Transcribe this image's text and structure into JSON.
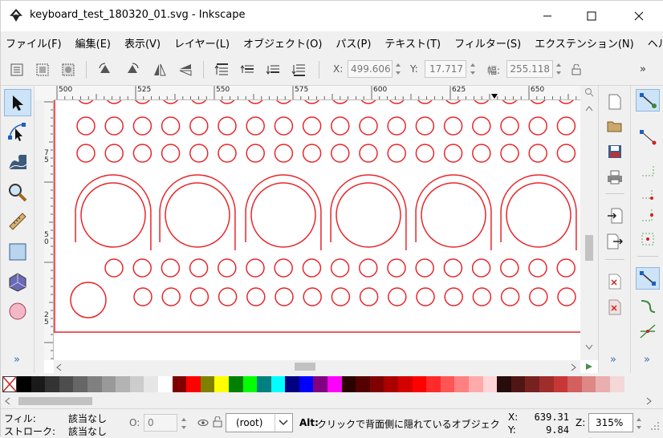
{
  "window": {
    "title": "keyboard_test_180320_01.svg - Inkscape",
    "minimize_glyph": "─",
    "maximize_glyph": "☐",
    "close_glyph": "✕"
  },
  "menu": [
    "ファイル(F)",
    "編集(E)",
    "表示(V)",
    "レイヤー(L)",
    "オブジェクト(O)",
    "パス(P)",
    "テキスト(T)",
    "フィルター(S)",
    "エクステンション(N)",
    "ヘルプ(H)"
  ],
  "toolbar": {
    "x_label": "X:",
    "x_value": "499.606",
    "y_label": "Y:",
    "y_value": "17.717",
    "w_label": "幅:",
    "w_value": "255.118",
    "overflow": "»"
  },
  "rulers": {
    "h_labels": [
      "500",
      "525",
      "550",
      "575",
      "600",
      "625",
      "650"
    ],
    "v_labels": [
      "7\n5",
      "5\n0",
      "2\n5"
    ]
  },
  "toolbox": {
    "overflow": "»"
  },
  "commands": {
    "overflow": "»"
  },
  "snap": {
    "overflow": "»"
  },
  "palette": {
    "colors": [
      "#000000",
      "#1a1a1a",
      "#333333",
      "#4d4d4d",
      "#666666",
      "#808080",
      "#999999",
      "#b3b3b3",
      "#cccccc",
      "#e6e6e6",
      "#ffffff",
      "#800000",
      "#ff0000",
      "#808000",
      "#ffff00",
      "#008000",
      "#00ff00",
      "#008080",
      "#00ffff",
      "#000080",
      "#0000ff",
      "#800080",
      "#ff00ff",
      "#2b0000",
      "#550000",
      "#800000",
      "#aa0000",
      "#d40000",
      "#ff0000",
      "#ff2a2a",
      "#ff5555",
      "#ff8080",
      "#ffaaaa",
      "#ffd5d5",
      "#280b0b",
      "#501616",
      "#782121",
      "#a02c2c",
      "#c83737",
      "#d35f5f",
      "#de8787",
      "#e9afaf",
      "#f4d7d7"
    ]
  },
  "status": {
    "fill_label": "フィル:",
    "fill_value": "該当なし",
    "stroke_label": "ストローク:",
    "stroke_value": "該当なし",
    "opacity_label": "O:",
    "opacity_value": "0",
    "layer_value": "(root)",
    "message_bold": "Alt:",
    "message": " クリックで背面側に隠れているオブジェク",
    "cursor_x_label": "X:",
    "cursor_x": "639.31",
    "cursor_y_label": "Y:",
    "cursor_y": "9.84",
    "zoom_label": "Z:",
    "zoom_value": "315%"
  },
  "colors": {
    "stroke": "#e8262b",
    "accent": "#cde3f7"
  }
}
